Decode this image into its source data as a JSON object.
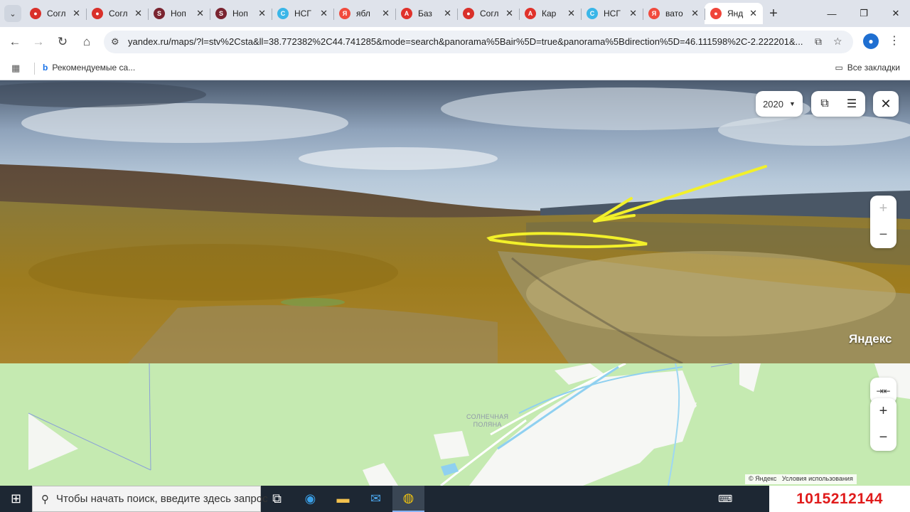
{
  "browser": {
    "tabs": [
      {
        "title": "Согл",
        "favicon_color": "#d9302a",
        "favicon_glyph": "●"
      },
      {
        "title": "Согл",
        "favicon_color": "#d9302a",
        "favicon_glyph": "●"
      },
      {
        "title": "Ноп",
        "favicon_color": "#7a2430",
        "favicon_glyph": "S"
      },
      {
        "title": "Ноп",
        "favicon_color": "#7a2430",
        "favicon_glyph": "S"
      },
      {
        "title": "НСГ",
        "favicon_color": "#3ab6e8",
        "favicon_glyph": "C"
      },
      {
        "title": "ябл",
        "favicon_color": "#f14b3d",
        "favicon_glyph": "Я"
      },
      {
        "title": "Баз",
        "favicon_color": "#e0322b",
        "favicon_glyph": "A"
      },
      {
        "title": "Согл",
        "favicon_color": "#d9302a",
        "favicon_glyph": "●"
      },
      {
        "title": "Кар",
        "favicon_color": "#e0322b",
        "favicon_glyph": "A"
      },
      {
        "title": "НСГ",
        "favicon_color": "#3ab6e8",
        "favicon_glyph": "C"
      },
      {
        "title": "вато",
        "favicon_color": "#f14b3d",
        "favicon_glyph": "Я"
      },
      {
        "title": "Янд",
        "favicon_color": "#f0453a",
        "favicon_glyph": "●",
        "active": true
      }
    ],
    "url": "yandex.ru/maps/?l=stv%2Csta&ll=38.772382%2C44.741285&mode=search&panorama%5Bair%5D=true&panorama%5Bdirection%5D=46.111598%2C-2.222201&...",
    "bookmarks": {
      "recommended": "Рекомендуемые са...",
      "all": "Все закладки"
    }
  },
  "panorama": {
    "year": "2020",
    "brand": "Яндекс"
  },
  "map": {
    "place_label_line1": "СОЛНЕЧНАЯ",
    "place_label_line2": "ПОЛЯНА",
    "copyright": "© Яндекс",
    "terms": "Условия использования"
  },
  "taskbar": {
    "search_placeholder": "Чтобы начать поиск, введите здесь запрос"
  },
  "overlay": {
    "phone": "1015212144"
  },
  "colors": {
    "annotation_arrow": "#f2f02a",
    "map_land": "#c5eab1",
    "map_river": "#8fd0f0",
    "phone_text": "#e01b1b"
  }
}
